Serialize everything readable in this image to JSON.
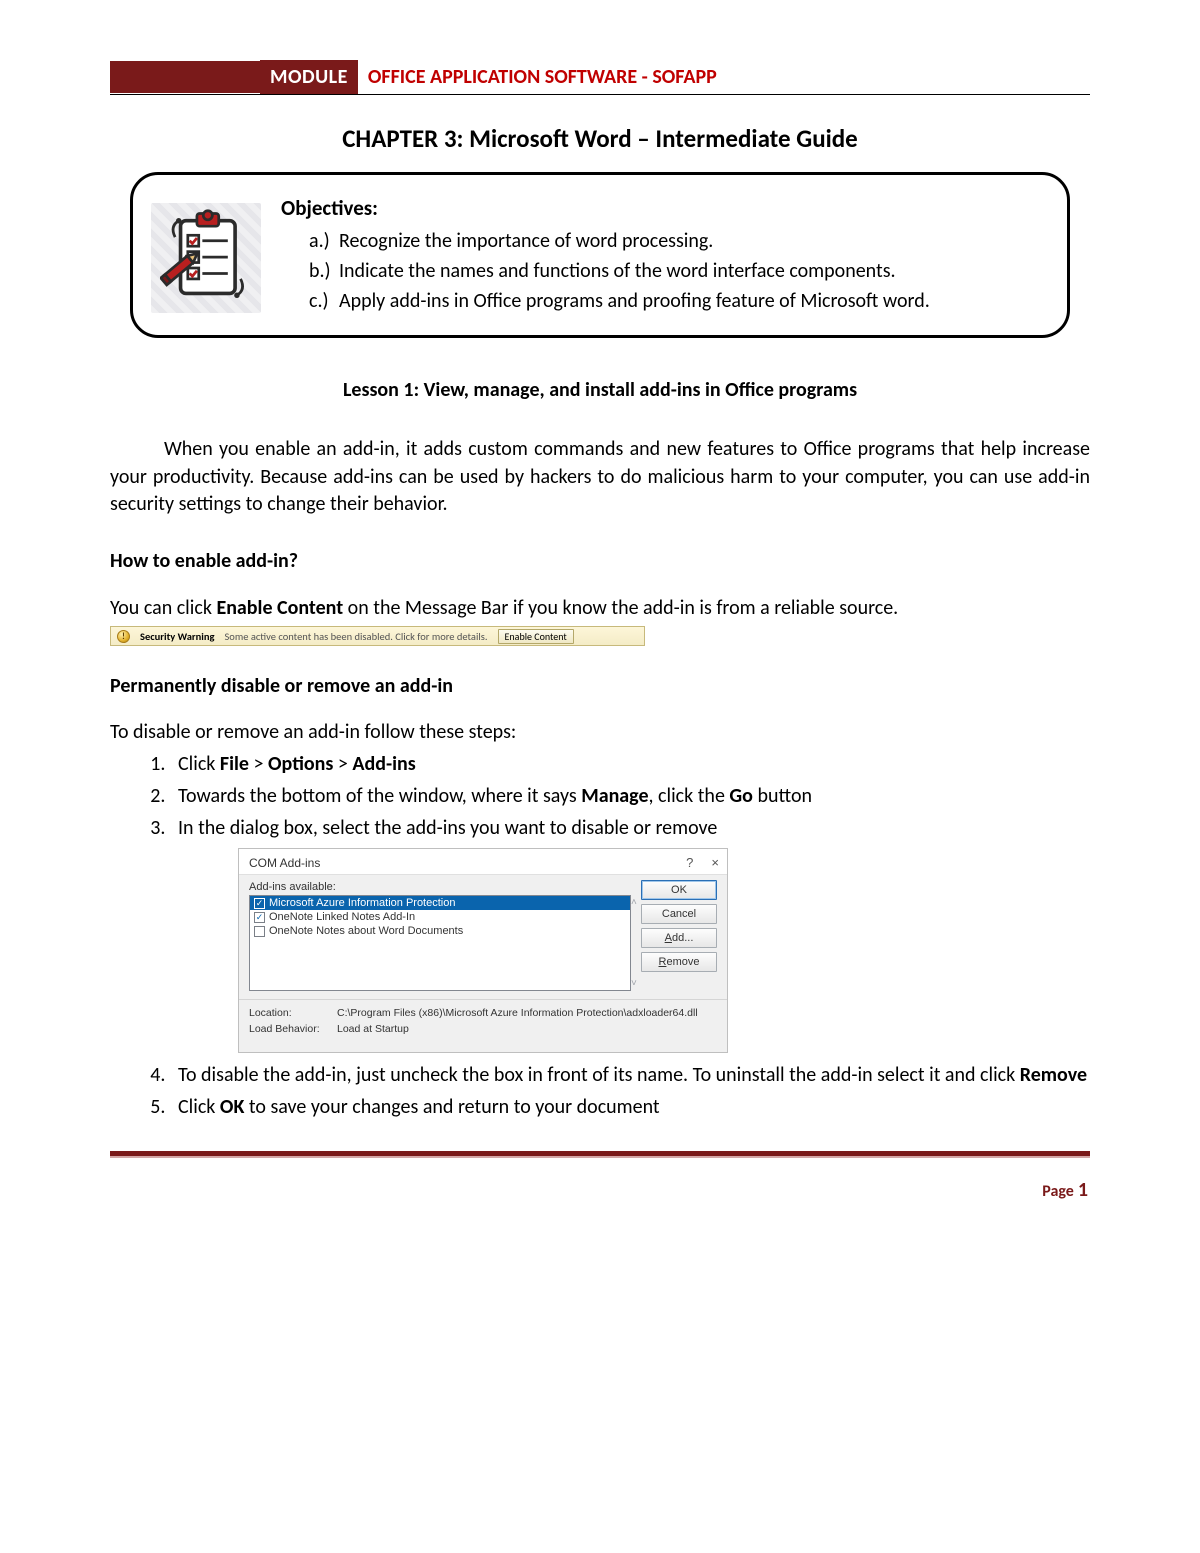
{
  "header": {
    "module_label": "MODULE",
    "course_title": "OFFICE APPLICATION SOFTWARE - SOFAPP"
  },
  "chapter_title": "CHAPTER 3: Microsoft Word – Intermediate Guide",
  "objectives": {
    "heading": "Objectives:",
    "items": [
      {
        "label": "a.)",
        "text": "Recognize the importance of word processing."
      },
      {
        "label": "b.)",
        "text": "Indicate the names and functions of the word interface components."
      },
      {
        "label": "c.)",
        "text": "Apply add-ins in Office programs and proofing feature of Microsoft word."
      }
    ]
  },
  "lesson_title": "Lesson 1: View, manage, and install add-ins in Office programs",
  "intro_para": "When you enable an add-in, it adds custom commands and new features to Office programs that help increase your productivity. Because add-ins can be used by hackers to do malicious harm to your computer, you can use add-in security settings to change their behavior.",
  "enable_heading": "How to enable add-in?",
  "enable_text_pre": "You can click ",
  "enable_text_bold": "Enable Content",
  "enable_text_post": " on the Message Bar if you know the add-in is from a reliable source.",
  "security_bar": {
    "bold": "Security Warning",
    "msg": "Some active content has been disabled. Click for more details.",
    "button": "Enable Content"
  },
  "disable_heading": "Permanently disable or remove an add-in",
  "steps_intro": "To disable or remove an add-in follow these steps:",
  "steps": {
    "s1_pre": "Click ",
    "s1_b1": "File",
    "s1_mid1": " > ",
    "s1_b2": "Options",
    "s1_mid2": " > ",
    "s1_b3": "Add-ins",
    "s2_pre": "Towards the bottom of the window, where it says ",
    "s2_b1": "Manage",
    "s2_mid": ", click the ",
    "s2_b2": "Go",
    "s2_post": " button",
    "s3": "In the dialog box, select the add-ins you want to disable or remove",
    "s4_pre": "To disable the add-in, just uncheck the box in front of its name. To uninstall the add-in select it and click ",
    "s4_b": "Remove",
    "s5_pre": "Click ",
    "s5_b": "OK",
    "s5_post": " to save your changes and return to your document"
  },
  "dialog": {
    "title": "COM Add-ins",
    "help": "?",
    "close": "×",
    "available_label": "Add-ins available:",
    "items": [
      {
        "checked": true,
        "selected": true,
        "label": "Microsoft Azure Information Protection"
      },
      {
        "checked": true,
        "selected": false,
        "label": "OneNote Linked Notes Add-In"
      },
      {
        "checked": false,
        "selected": false,
        "label": "OneNote Notes about Word Documents"
      }
    ],
    "buttons": {
      "ok": "OK",
      "cancel": "Cancel",
      "add": "Add...",
      "remove": "Remove"
    },
    "location_label": "Location:",
    "location_value": "C:\\Program Files (x86)\\Microsoft Azure Information Protection\\adxloader64.dll",
    "load_label": "Load Behavior:",
    "load_value": "Load at Startup"
  },
  "footer": {
    "page_label": "Page",
    "page_number": "1"
  }
}
